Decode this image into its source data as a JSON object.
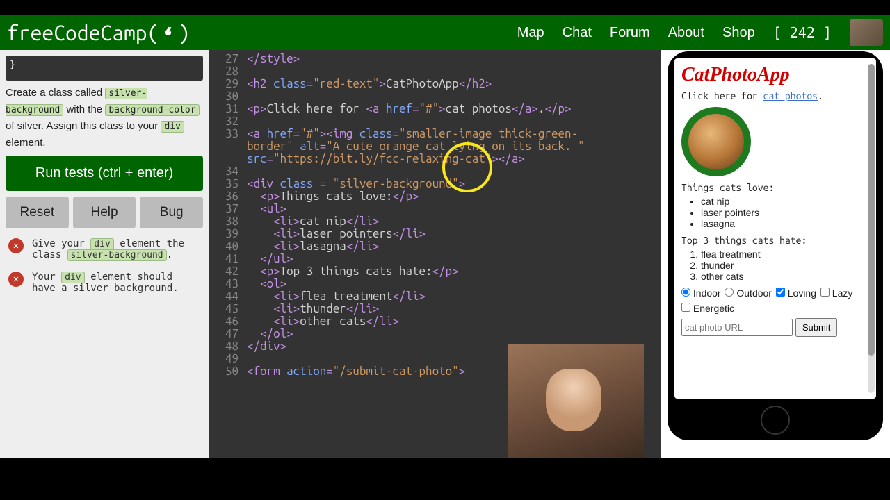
{
  "logo": "freeCodeCamp(",
  "nav": {
    "map": "Map",
    "chat": "Chat",
    "forum": "Forum",
    "about": "About",
    "shop": "Shop",
    "points": "[ 242 ]"
  },
  "left": {
    "codePreview": "}",
    "instr_pre": "Create a class called ",
    "chip1": "silver-background",
    "instr_mid1": " with the ",
    "chip2": "background-color",
    "instr_mid2": " of silver. Assign this class to your ",
    "chip3": "div",
    "instr_end": " element.",
    "run": "Run tests (ctrl + enter)",
    "reset": "Reset",
    "help": "Help",
    "bug": "Bug",
    "test1_a": "Give your ",
    "test1_chip1": "div",
    "test1_b": " element the class ",
    "test1_chip2": "silver-background",
    "test1_c": ".",
    "test2_a": "Your ",
    "test2_chip1": "div",
    "test2_b": " element should have a silver background."
  },
  "editor": {
    "lines": [
      {
        "n": "27",
        "raw": "</style>",
        "tk": [
          [
            "tag",
            "</style>"
          ]
        ]
      },
      {
        "n": "28",
        "raw": "",
        "tk": []
      },
      {
        "n": "29",
        "raw": "<h2 class=\"red-text\">CatPhotoApp</h2>",
        "tk": [
          [
            "tag",
            "<h2 "
          ],
          [
            "attr",
            "class"
          ],
          [
            "tag",
            "="
          ],
          [
            "str",
            "\"red-text\""
          ],
          [
            "tag",
            ">"
          ],
          [
            "txt",
            "CatPhotoApp"
          ],
          [
            "tag",
            "</h2>"
          ]
        ]
      },
      {
        "n": "30",
        "raw": "",
        "tk": []
      },
      {
        "n": "31",
        "raw": "<p>Click here for <a href=\"#\">cat photos</a>.</p>",
        "tk": [
          [
            "tag",
            "<p>"
          ],
          [
            "txt",
            "Click here for "
          ],
          [
            "tag",
            "<a "
          ],
          [
            "attr",
            "href"
          ],
          [
            "tag",
            "="
          ],
          [
            "str",
            "\"#\""
          ],
          [
            "tag",
            ">"
          ],
          [
            "txt",
            "cat photos"
          ],
          [
            "tag",
            "</a>"
          ],
          [
            "txt",
            "."
          ],
          [
            "tag",
            "</p>"
          ]
        ]
      },
      {
        "n": "32",
        "raw": "",
        "tk": []
      },
      {
        "n": "33",
        "raw": "<a href=\"#\"><img class=\"smaller-image thick-green-",
        "tk": [
          [
            "tag",
            "<a "
          ],
          [
            "attr",
            "href"
          ],
          [
            "tag",
            "="
          ],
          [
            "str",
            "\"#\""
          ],
          [
            "tag",
            "><img "
          ],
          [
            "attr",
            "class"
          ],
          [
            "tag",
            "="
          ],
          [
            "str",
            "\"smaller-image thick-green-"
          ]
        ]
      },
      {
        "n": "",
        "raw": "border\" alt=\"A cute orange cat lying on its back. \"",
        "tk": [
          [
            "str",
            "border\" "
          ],
          [
            "attr",
            "alt"
          ],
          [
            "tag",
            "="
          ],
          [
            "str",
            "\"A cute orange cat lying on its back. \""
          ]
        ]
      },
      {
        "n": "",
        "raw": "src=\"https://bit.ly/fcc-relaxing-cat\"></a>",
        "tk": [
          [
            "attr",
            "src"
          ],
          [
            "tag",
            "="
          ],
          [
            "str",
            "\"https://bit.ly/fcc-relaxing-cat\""
          ],
          [
            "tag",
            "></a>"
          ]
        ]
      },
      {
        "n": "34",
        "raw": "",
        "tk": []
      },
      {
        "n": "35",
        "raw": "<div class = \"silver-background\">",
        "tk": [
          [
            "tag",
            "<div "
          ],
          [
            "attr",
            "class"
          ],
          [
            "tag",
            " = "
          ],
          [
            "str",
            "\"silver-background\""
          ],
          [
            "tag",
            ">"
          ]
        ]
      },
      {
        "n": "36",
        "raw": "  <p>Things cats love:</p>",
        "tk": [
          [
            "txt",
            "  "
          ],
          [
            "tag",
            "<p>"
          ],
          [
            "txt",
            "Things cats love:"
          ],
          [
            "tag",
            "</p>"
          ]
        ]
      },
      {
        "n": "37",
        "raw": "  <ul>",
        "tk": [
          [
            "txt",
            "  "
          ],
          [
            "tag",
            "<ul>"
          ]
        ]
      },
      {
        "n": "38",
        "raw": "    <li>cat nip</li>",
        "tk": [
          [
            "txt",
            "    "
          ],
          [
            "tag",
            "<li>"
          ],
          [
            "txt",
            "cat nip"
          ],
          [
            "tag",
            "</li>"
          ]
        ]
      },
      {
        "n": "39",
        "raw": "    <li>laser pointers</li>",
        "tk": [
          [
            "txt",
            "    "
          ],
          [
            "tag",
            "<li>"
          ],
          [
            "txt",
            "laser pointers"
          ],
          [
            "tag",
            "</li>"
          ]
        ]
      },
      {
        "n": "40",
        "raw": "    <li>lasagna</li>",
        "tk": [
          [
            "txt",
            "    "
          ],
          [
            "tag",
            "<li>"
          ],
          [
            "txt",
            "lasagna"
          ],
          [
            "tag",
            "</li>"
          ]
        ]
      },
      {
        "n": "41",
        "raw": "  </ul>",
        "tk": [
          [
            "txt",
            "  "
          ],
          [
            "tag",
            "</ul>"
          ]
        ]
      },
      {
        "n": "42",
        "raw": "  <p>Top 3 things cats hate:</p>",
        "tk": [
          [
            "txt",
            "  "
          ],
          [
            "tag",
            "<p>"
          ],
          [
            "txt",
            "Top 3 things cats hate:"
          ],
          [
            "tag",
            "</p>"
          ]
        ]
      },
      {
        "n": "43",
        "raw": "  <ol>",
        "tk": [
          [
            "txt",
            "  "
          ],
          [
            "tag",
            "<ol>"
          ]
        ]
      },
      {
        "n": "44",
        "raw": "    <li>flea treatment</li>",
        "tk": [
          [
            "txt",
            "    "
          ],
          [
            "tag",
            "<li>"
          ],
          [
            "txt",
            "flea treatment"
          ],
          [
            "tag",
            "</li>"
          ]
        ]
      },
      {
        "n": "45",
        "raw": "    <li>thunder</li>",
        "tk": [
          [
            "txt",
            "    "
          ],
          [
            "tag",
            "<li>"
          ],
          [
            "txt",
            "thunder"
          ],
          [
            "tag",
            "</li>"
          ]
        ]
      },
      {
        "n": "46",
        "raw": "    <li>other cats</li>",
        "tk": [
          [
            "txt",
            "    "
          ],
          [
            "tag",
            "<li>"
          ],
          [
            "txt",
            "other cats"
          ],
          [
            "tag",
            "</li>"
          ]
        ]
      },
      {
        "n": "47",
        "raw": "  </ol>",
        "tk": [
          [
            "txt",
            "  "
          ],
          [
            "tag",
            "</ol>"
          ]
        ]
      },
      {
        "n": "48",
        "raw": "</div>",
        "tk": [
          [
            "tag",
            "</div>"
          ]
        ]
      },
      {
        "n": "49",
        "raw": "",
        "tk": []
      },
      {
        "n": "50",
        "raw": "<form action=\"/submit-cat-photo\">",
        "tk": [
          [
            "tag",
            "<form "
          ],
          [
            "attr",
            "action"
          ],
          [
            "tag",
            "="
          ],
          [
            "str",
            "\"/submit-cat-photo\""
          ],
          [
            "tag",
            ">"
          ]
        ]
      }
    ]
  },
  "preview": {
    "title": "CatPhotoApp",
    "p1_a": "Click here for ",
    "p1_link": "cat photos",
    "p1_b": ".",
    "love_h": "Things cats love:",
    "love": [
      "cat nip",
      "laser pointers",
      "lasagna"
    ],
    "hate_h": "Top 3 things cats hate:",
    "hate": [
      "flea treatment",
      "thunder",
      "other cats"
    ],
    "radio1": "Indoor",
    "radio2": "Outdoor",
    "chk1": "Loving",
    "chk2": "Lazy",
    "chk3": "Energetic",
    "placeholder": "cat photo URL",
    "submit": "Submit"
  }
}
